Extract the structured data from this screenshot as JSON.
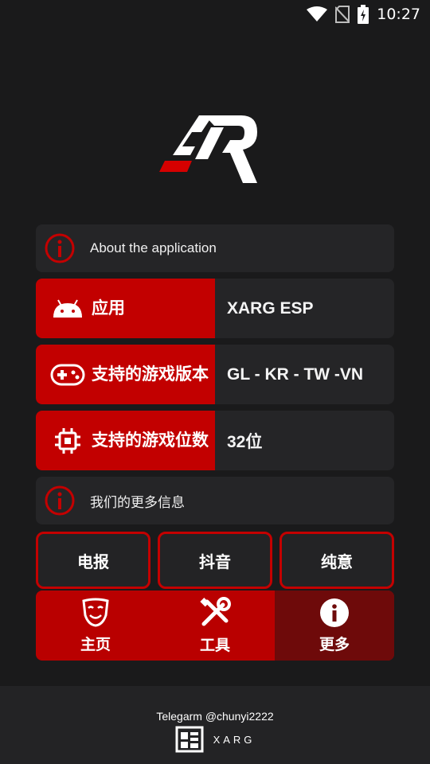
{
  "status_bar": {
    "time": "10:27"
  },
  "about": {
    "label": "About the application"
  },
  "specs": [
    {
      "key": "应用",
      "value": "XARG ESP"
    },
    {
      "key": "支持的游戏版本",
      "value": "GL - KR - TW -VN"
    },
    {
      "key": "支持的游戏位数",
      "value": "32位"
    }
  ],
  "more_info": {
    "label": "我们的更多信息"
  },
  "links": [
    "电报",
    "抖音",
    "纯意"
  ],
  "tabs": [
    {
      "label": "主页",
      "icon": "mask-icon"
    },
    {
      "label": "工具",
      "icon": "tools-icon"
    },
    {
      "label": "更多",
      "icon": "info-icon"
    }
  ],
  "footer": {
    "credit": "Telegarm @chunyi2222",
    "brand": "XARG"
  },
  "colors": {
    "accent": "#c20000",
    "background": "#1a1a1b",
    "card": "#252527",
    "active_tab": "#6e0a0a"
  }
}
